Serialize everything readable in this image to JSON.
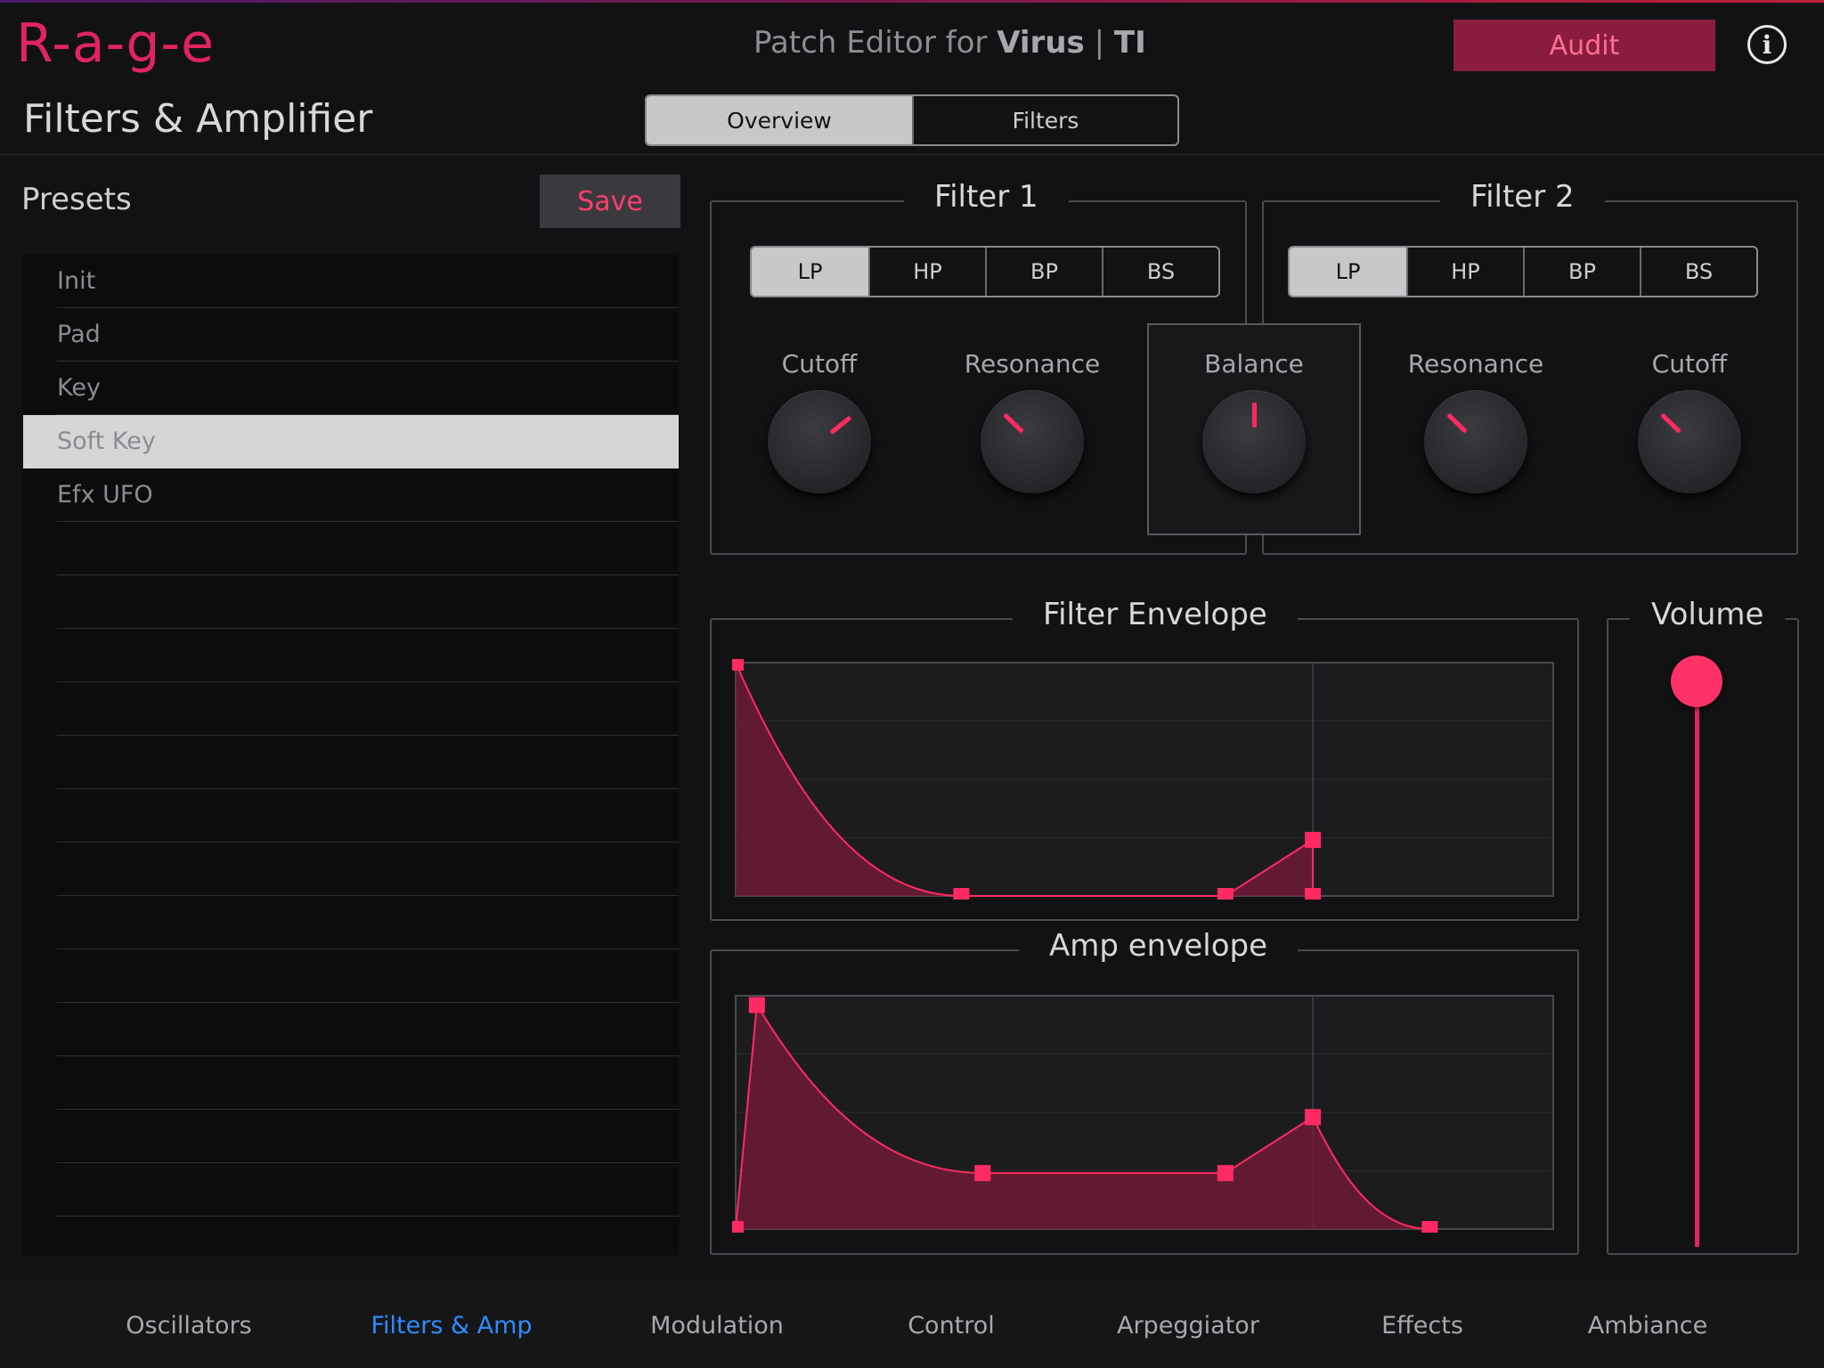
{
  "header": {
    "logo": "R-a-g-e",
    "title_prefix": "Patch Editor for",
    "title_brand": "Virus",
    "title_sep": "|",
    "title_suffix": "TI",
    "audit_label": "Audit",
    "info_icon": "i"
  },
  "page": {
    "title": "Filters & Amplifier",
    "tabs": [
      {
        "label": "Overview",
        "active": true
      },
      {
        "label": "Filters",
        "active": false
      }
    ]
  },
  "presets": {
    "label": "Presets",
    "save_label": "Save",
    "items": [
      "Init",
      "Pad",
      "Key",
      "Soft Key",
      "Efx UFO"
    ],
    "selected": "Soft Key"
  },
  "filter1": {
    "title": "Filter 1",
    "types": [
      "LP",
      "HP",
      "BP",
      "BS"
    ],
    "active_type": "LP",
    "cutoff_label": "Cutoff",
    "cutoff_value": 0.69,
    "resonance_label": "Resonance",
    "resonance_value": 0.33
  },
  "filter2": {
    "title": "Filter 2",
    "types": [
      "LP",
      "HP",
      "BP",
      "BS"
    ],
    "active_type": "LP",
    "cutoff_label": "Cutoff",
    "cutoff_value": 0.33,
    "resonance_label": "Resonance",
    "resonance_value": 0.33
  },
  "balance": {
    "label": "Balance",
    "value": 0.5
  },
  "filter_envelope": {
    "title": "Filter Envelope",
    "points": [
      [
        0,
        1.0
      ],
      [
        0.276,
        0.0
      ],
      [
        0.599,
        0.0
      ],
      [
        0.706,
        0.24
      ],
      [
        0.706,
        0.0
      ]
    ]
  },
  "amp_envelope": {
    "title": "Amp envelope",
    "points": [
      [
        0,
        0.0
      ],
      [
        0.026,
        0.96
      ],
      [
        0.302,
        0.24
      ],
      [
        0.599,
        0.24
      ],
      [
        0.706,
        0.48
      ],
      [
        0.849,
        0.0
      ]
    ]
  },
  "volume": {
    "label": "Volume",
    "value": 1.0
  },
  "colors": {
    "accent": "#ff2a62",
    "envelope_fill": "#7a1a3a",
    "nav_active": "#2f8cff"
  },
  "nav": {
    "items": [
      "Oscillators",
      "Filters & Amp",
      "Modulation",
      "Control",
      "Arpeggiator",
      "Effects",
      "Ambiance"
    ],
    "active": "Filters & Amp"
  }
}
